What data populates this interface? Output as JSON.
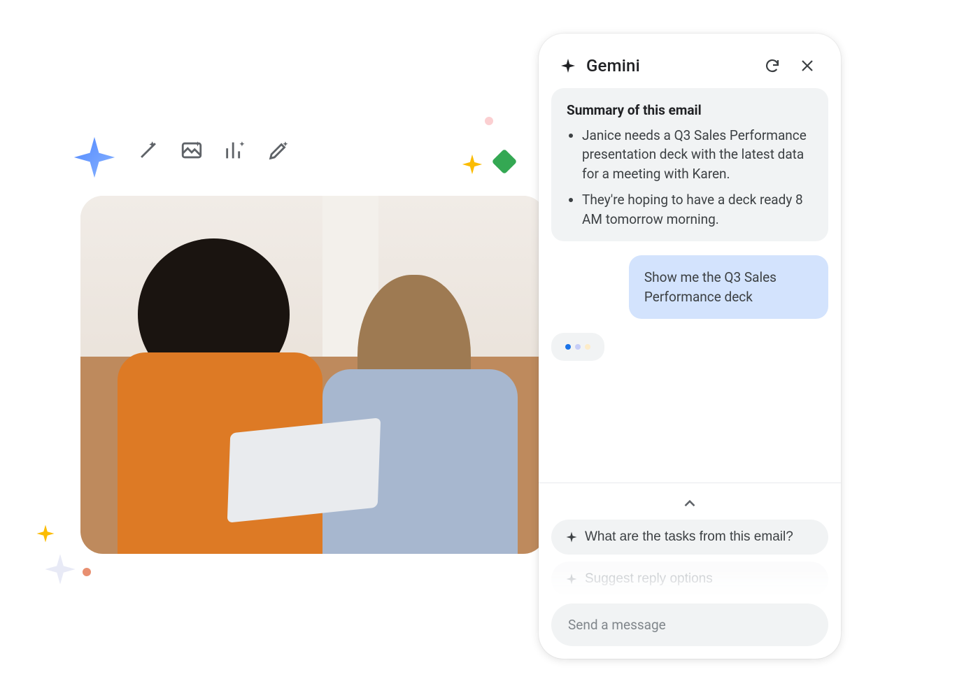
{
  "panel": {
    "title": "Gemini",
    "buttons": {
      "refresh": "Refresh",
      "close": "Close"
    }
  },
  "summary": {
    "heading": "Summary of this email",
    "bullets": [
      "Janice needs a Q3 Sales Performance presentation deck with the latest data for a meeting with Karen.",
      "They're hoping to have a deck ready 8 AM tomorrow morning."
    ]
  },
  "userMessage": "Show me the Q3 Sales Performance deck",
  "suggestions": {
    "0": "What are the tasks from this email?",
    "1": "Suggest reply options"
  },
  "input": {
    "placeholder": "Send a message"
  },
  "toolbar_icons": {
    "0": "magic-wand-icon",
    "1": "image-sparkle-icon",
    "2": "chart-sparkle-icon",
    "3": "pen-sparkle-icon"
  }
}
